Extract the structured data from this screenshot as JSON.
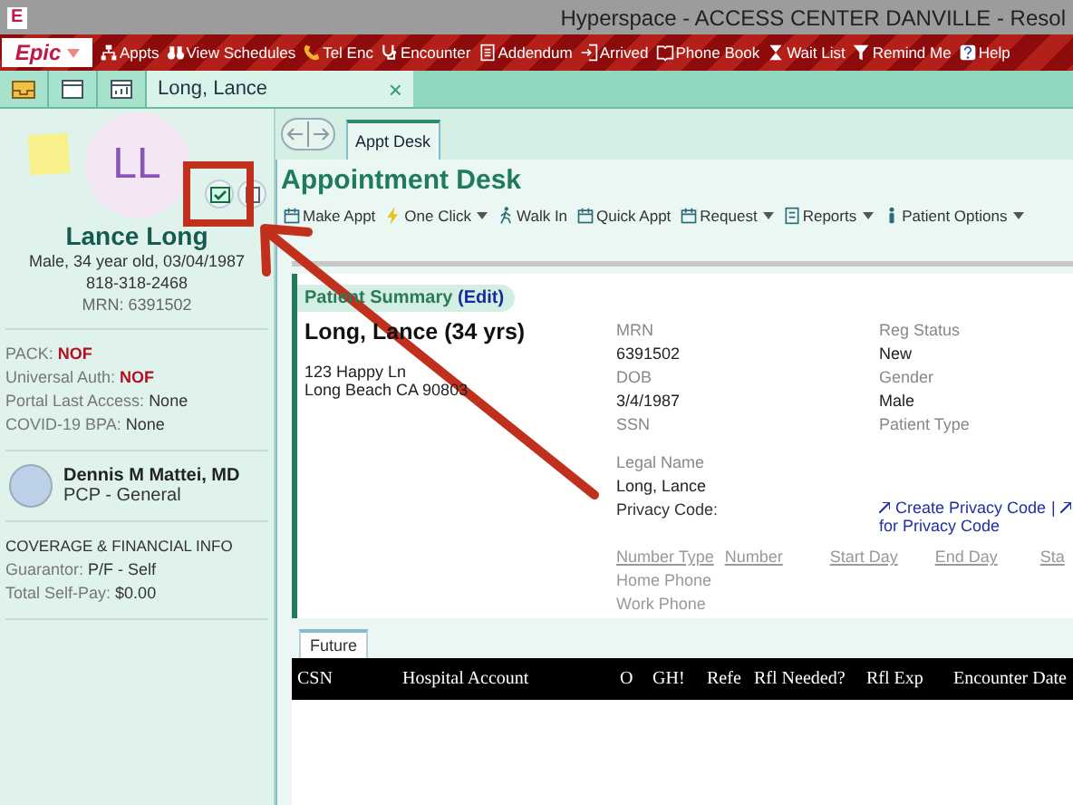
{
  "window": {
    "app_letter": "E",
    "title": "Hyperspace - ACCESS CENTER DANVILLE - Resol"
  },
  "toolbar": {
    "logo": "Epic",
    "items": [
      "Appts",
      "View Schedules",
      "Tel Enc",
      "Encounter",
      "Addendum",
      "Arrived",
      "Phone Book",
      "Wait List",
      "Remind Me",
      "Help"
    ]
  },
  "workspace_tabs": {
    "patient_tab": {
      "label": "Long, Lance",
      "close": "×"
    }
  },
  "patient_panel": {
    "initials": "LL",
    "name": "Lance Long",
    "details": [
      "Male, 34 year old, 03/04/1987",
      "818-318-2468",
      "MRN: 6391502"
    ],
    "flags": [
      {
        "label": "PACK:",
        "value": "NOF",
        "alert": true
      },
      {
        "label": "Universal Auth:",
        "value": "NOF",
        "alert": true
      },
      {
        "label": "Portal Last Access:",
        "value": "None",
        "alert": false
      },
      {
        "label": "COVID-19 BPA:",
        "value": "None",
        "alert": false
      }
    ],
    "provider": {
      "name": "Dennis M Mattei, MD",
      "role": "PCP - General"
    },
    "coverage": {
      "heading": "COVERAGE & FINANCIAL INFO",
      "rows": [
        {
          "label": "Guarantor:",
          "value": "P/F - Self"
        },
        {
          "label": "Total Self-Pay:",
          "value": "$0.00"
        }
      ]
    }
  },
  "activity_tab": "Appt Desk",
  "heading": "Appointment Desk",
  "actions": [
    {
      "label": "Make Appt",
      "dropdown": false
    },
    {
      "label": "One Click",
      "dropdown": true
    },
    {
      "label": "Walk In",
      "dropdown": false
    },
    {
      "label": "Quick Appt",
      "dropdown": false
    },
    {
      "label": "Request",
      "dropdown": true
    },
    {
      "label": "Reports",
      "dropdown": true
    },
    {
      "label": "Patient Options",
      "dropdown": true
    }
  ],
  "summary": {
    "title": "Patient Summary",
    "edit": "(Edit)",
    "patient": "Long, Lance (34 yrs)",
    "address": [
      "123 Happy Ln",
      "Long Beach CA 90803"
    ],
    "fields_1": [
      {
        "label": "MRN",
        "value": "6391502"
      },
      {
        "label": "DOB",
        "value": "3/4/1987"
      },
      {
        "label": "SSN"
      }
    ],
    "fields_2": [
      {
        "label": "Reg Status",
        "value": "New"
      },
      {
        "label": "Gender",
        "value": "Male"
      },
      {
        "label": "Patient Type"
      }
    ],
    "legal_name": {
      "label": "Legal Name",
      "value": "Long, Lance"
    },
    "privacy": {
      "label": "Privacy Code:",
      "links": [
        "Create Privacy Code",
        "for Privacy Code"
      ],
      "separator": "|"
    },
    "phones": {
      "columns": [
        "Number Type",
        "Number",
        "Start Day",
        "End Day",
        "Sta"
      ],
      "rows": [
        "Home Phone",
        "Work Phone"
      ]
    }
  },
  "appointments": {
    "tabs": [
      {
        "label": "Future",
        "selected": true
      }
    ],
    "columns": [
      "CSN",
      "Hospital Account",
      "O",
      "GH!",
      "Refe",
      "Rfl Needed?",
      "Rfl Exp",
      "Encounter Date"
    ]
  }
}
